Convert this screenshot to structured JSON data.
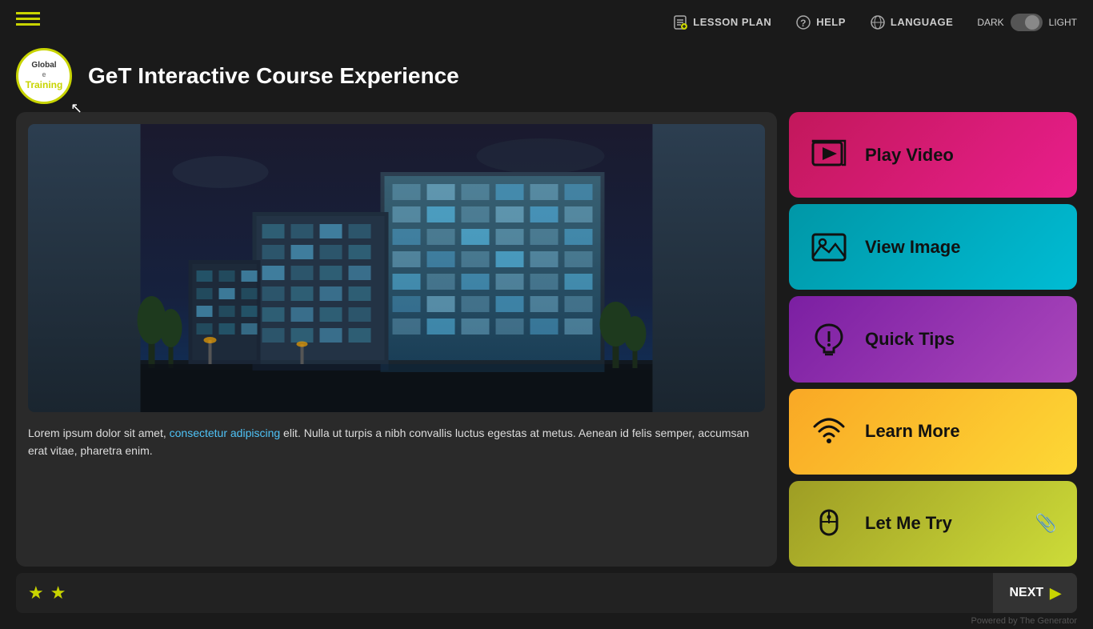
{
  "header": {
    "title": "GeT Interactive Course Experience",
    "hamburger_label": "Menu"
  },
  "nav": {
    "lesson_plan": "LESSON PLAN",
    "help": "HELP",
    "language": "LANGUAGE",
    "dark_label": "DARK",
    "light_label": "LIGHT"
  },
  "logo": {
    "global": "Global",
    "etraining": "eTraining",
    "symbol": "e"
  },
  "content": {
    "body_text_normal_1": "Lorem ipsum dolor sit amet, ",
    "body_text_highlight": "consectetur adipiscing",
    "body_text_normal_2": " elit. Nulla ut turpis a nibh convallis luctus egestas at metus. Aenean id felis semper, accumsan erat vitae, pharetra enim."
  },
  "buttons": {
    "play_video": "Play Video",
    "view_image": "View Image",
    "quick_tips": "Quick Tips",
    "learn_more": "Learn More",
    "let_me_try": "Let Me Try"
  },
  "bottom": {
    "next_label": "NEXT",
    "star1": "★",
    "star2": "★"
  },
  "footer": {
    "powered_by": "Powered by The Generator"
  }
}
